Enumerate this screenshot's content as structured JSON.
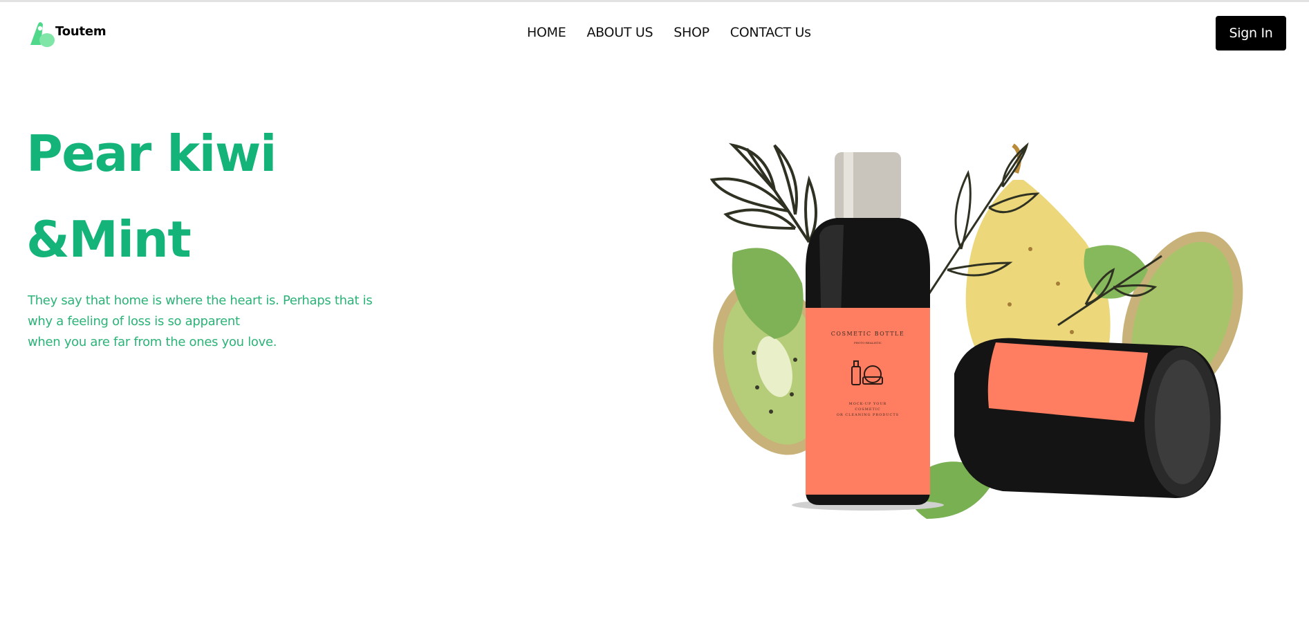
{
  "brand": {
    "name": "Toutem",
    "accent": "#13b37a",
    "logo_color": "#4fd88a"
  },
  "nav": {
    "items": [
      "HOME",
      "ABOUT US",
      "SHOP",
      "CONTACT Us"
    ]
  },
  "signin": {
    "label": "Sign In"
  },
  "hero": {
    "title_line1": "Pear kiwi",
    "title_line2": "&Mint",
    "text_lines": [
      "They say that home is where the heart is. Perhaps that is",
      "why a feeling of loss is so apparent",
      "when you are far from the ones you love."
    ]
  },
  "product": {
    "label_title": "COSMETIC BOTTLE",
    "label_sub": "PHOTO-REALISTIC",
    "label_body1": "MOCK-UP YOUR",
    "label_body2": "COSMETIC",
    "label_body3": "OR CLEANING PRODUCTS"
  },
  "icons": [
    "logo-icon"
  ]
}
